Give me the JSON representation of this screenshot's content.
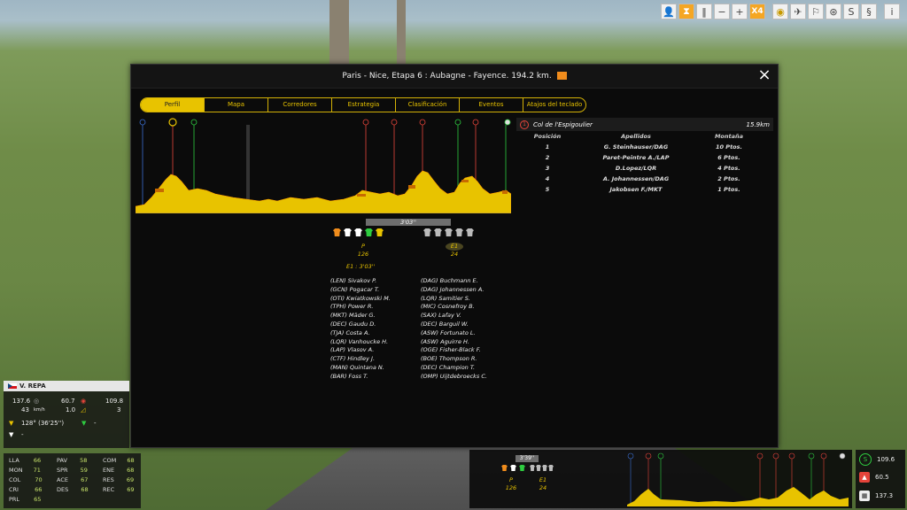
{
  "dialog": {
    "title": "Paris - Nice, Etapa 6 : Aubagne - Fayence. 194.2 km.",
    "close_label": "×"
  },
  "tabs": [
    "Perfil",
    "Mapa",
    "Corredores",
    "Estrategia",
    "Clasificación",
    "Eventos",
    "Atajos del teclado"
  ],
  "ranking": {
    "climb_name": "Col de l'Espigoulier",
    "distance": "15.9km",
    "headers": [
      "Posición",
      "Apellidos",
      "Montaña"
    ],
    "rows": [
      [
        "1",
        "G. Steinhauser/DAG",
        "10 Ptos."
      ],
      [
        "2",
        "Paret-Peintre A./LAP",
        "6 Ptos."
      ],
      [
        "3",
        "D.Lopez/LQR",
        "4 Ptos."
      ],
      [
        "4",
        "A. Johannessen/DAG",
        "2 Ptos."
      ],
      [
        "5",
        "Jakobsen F./MKT",
        "1 Ptos."
      ]
    ]
  },
  "groups": {
    "gap": "3'03''",
    "lead_label": "P",
    "lead_count": "126",
    "chase_label": "E1",
    "chase_count": "24",
    "chase_time": "E1 : 3'03''",
    "col1": [
      "(LEN) Sivakov P.",
      "(GCN) Pogacar T.",
      "(OTI) Kwiatkowski M.",
      "(TPH) Power R.",
      "(MKT) Mäder G.",
      "(DEC) Gaudu D.",
      "(TJA) Costa A.",
      "(LQR) Vanhoucke H.",
      "(LAP) Vlasov A.",
      "(CTF) Hindley J.",
      "(MAN) Quintana N.",
      "(BAR) Foss T."
    ],
    "col2": [
      "(DAG) Buchmann E.",
      "(DAG) Johannessen A.",
      "(LQR) Samitier S.",
      "(MIC) Cosnefroy B.",
      "(SAX) Lafay V.",
      "(DEC) Barguil W.",
      "(ASW) Fortunato L.",
      "(ASW) Aguirre H.",
      "(OGE) Fisher-Black F.",
      "(BOE) Thompson R.",
      "(DEC) Champion T.",
      "(OMP) Uijtdebroecks C."
    ]
  },
  "rider": {
    "name": "V. REPA",
    "ranking": "128° (36'25'')",
    "green_value": "-",
    "white_value": "-",
    "v1": "137.6",
    "v2": "60.7",
    "v3": "109.8",
    "speed": "43",
    "speed_unit": "km/h",
    "slope": "1.0",
    "gear": "3"
  },
  "stats": [
    [
      "LLA",
      "66"
    ],
    [
      "MON",
      "71"
    ],
    [
      "COL",
      "70"
    ],
    [
      "CRI",
      "66"
    ],
    [
      "PRL",
      "65"
    ],
    [
      "PAV",
      "58"
    ],
    [
      "SPR",
      "59"
    ],
    [
      "ACE",
      "67"
    ],
    [
      "DES",
      "68"
    ],
    [
      "COM",
      "68"
    ],
    [
      "ENE",
      "68"
    ],
    [
      "RES",
      "69"
    ],
    [
      "REC",
      "69"
    ]
  ],
  "mini": {
    "gap": "3'39''",
    "lead_label": "P",
    "lead_count": "126",
    "chase_label": "E1",
    "chase_count": "24"
  },
  "right_stats": [
    "109.6",
    "60.5",
    "137.3"
  ],
  "toolbar": {
    "speed_label": "X4",
    "info_label": "i"
  },
  "colors": {
    "accent": "#e8c300",
    "sprint": "#2ecc40",
    "climb": "#e5443a",
    "profile": "#e8c300"
  }
}
